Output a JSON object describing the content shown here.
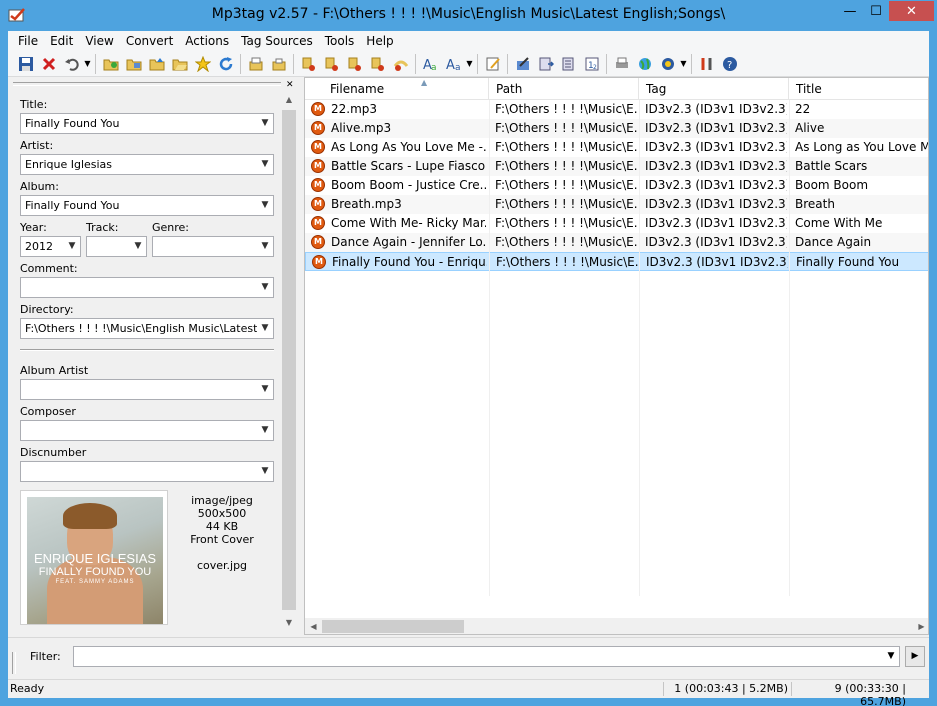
{
  "window": {
    "title": "Mp3tag v2.57  -  F:\\Others ! ! ! !\\Music\\English Music\\Latest English;Songs\\",
    "minimize": "—",
    "maximize": "☐",
    "close": "✕"
  },
  "menu": [
    "File",
    "Edit",
    "View",
    "Convert",
    "Actions",
    "Tag Sources",
    "Tools",
    "Help"
  ],
  "toolbar": {
    "icons": [
      "save-icon",
      "remove-tag-icon",
      "undo-icon",
      "add-directory-icon",
      "change-directory-icon",
      "add-file-icon",
      "open-folder-icon",
      "favorites-icon",
      "refresh-icon",
      "export-icon",
      "import-icon",
      "tag-to-filename-icon",
      "filename-to-tag-icon",
      "text-file-to-tag-icon",
      "tag-to-tag-icon",
      "auto-numbering-icon",
      "actions-icon",
      "quick-actions-icon",
      "extended-tags-icon",
      "edit-tags-icon",
      "convert-icon",
      "playlist-icon",
      "numbering-icon",
      "print-icon",
      "web-sources-icon",
      "freedb-icon",
      "options-icon",
      "help-icon"
    ]
  },
  "tagpanel": {
    "title_label": "Title:",
    "title_value": "Finally Found You",
    "artist_label": "Artist:",
    "artist_value": "Enrique Iglesias",
    "album_label": "Album:",
    "album_value": "Finally Found You",
    "year_label": "Year:",
    "year_value": "2012",
    "track_label": "Track:",
    "track_value": "",
    "genre_label": "Genre:",
    "genre_value": "",
    "comment_label": "Comment:",
    "comment_value": "",
    "directory_label": "Directory:",
    "directory_value": "F:\\Others ! ! ! !\\Music\\English Music\\Latest Engl",
    "album_artist_label": "Album Artist",
    "album_artist_value": "",
    "composer_label": "Composer",
    "composer_value": "",
    "discnumber_label": "Discnumber",
    "discnumber_value": "",
    "cover": {
      "artist_text": "ENRIQUE IGLESIAS",
      "song_text": "FINALLY FOUND YOU",
      "feat_text": "FEAT. SAMMY ADAMS",
      "mime": "image/jpeg",
      "size": "500x500",
      "filesize": "44 KB",
      "type": "Front Cover",
      "filename": "cover.jpg"
    }
  },
  "filelist": {
    "columns": [
      "Filename",
      "Path",
      "Tag",
      "Title"
    ],
    "rows": [
      {
        "filename": "22.mp3",
        "path": "F:\\Others ! ! ! !\\Music\\E...",
        "tag": "ID3v2.3 (ID3v1 ID3v2.3)",
        "title": "22"
      },
      {
        "filename": "Alive.mp3",
        "path": "F:\\Others ! ! ! !\\Music\\E...",
        "tag": "ID3v2.3 (ID3v1 ID3v2.3)",
        "title": "Alive"
      },
      {
        "filename": "As Long As You Love Me -...",
        "path": "F:\\Others ! ! ! !\\Music\\E...",
        "tag": "ID3v2.3 (ID3v1 ID3v2.3)",
        "title": "As Long as You Love Me"
      },
      {
        "filename": "Battle Scars - Lupe Fiasco f...",
        "path": "F:\\Others ! ! ! !\\Music\\E...",
        "tag": "ID3v2.3 (ID3v1 ID3v2.3)",
        "title": "Battle Scars"
      },
      {
        "filename": "Boom Boom - Justice Cre...",
        "path": "F:\\Others ! ! ! !\\Music\\E...",
        "tag": "ID3v2.3 (ID3v1 ID3v2.3)",
        "title": "Boom Boom"
      },
      {
        "filename": "Breath.mp3",
        "path": "F:\\Others ! ! ! !\\Music\\E...",
        "tag": "ID3v2.3 (ID3v1 ID3v2.3)",
        "title": "Breath"
      },
      {
        "filename": "Come With Me- Ricky Mar...",
        "path": "F:\\Others ! ! ! !\\Music\\E...",
        "tag": "ID3v2.3 (ID3v1 ID3v2.3)",
        "title": "Come With Me"
      },
      {
        "filename": "Dance Again - Jennifer Lo...",
        "path": "F:\\Others ! ! ! !\\Music\\E...",
        "tag": "ID3v2.3 (ID3v1 ID3v2.3)",
        "title": "Dance Again"
      },
      {
        "filename": "Finally Found You - Enriqu...",
        "path": "F:\\Others ! ! ! !\\Music\\E...",
        "tag": "ID3v2.3 (ID3v1 ID3v2.3)",
        "title": "Finally Found You"
      }
    ],
    "selected_index": 8
  },
  "filter": {
    "label": "Filter:",
    "value": ""
  },
  "status": {
    "ready": "Ready",
    "selected": "1 (00:03:43 | 5.2MB)",
    "total": "9 (00:33:30 | 65.7MB)"
  },
  "colors": {
    "titlebar": "#4ea3df",
    "selection": "#cce8ff",
    "close": "#c75050"
  }
}
